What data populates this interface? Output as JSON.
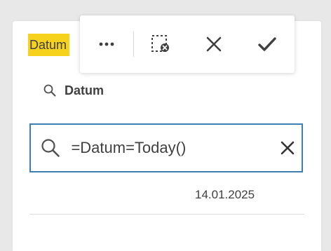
{
  "field": {
    "label": "Datum"
  },
  "toolbar": {
    "more_icon": "more-horizontal-icon",
    "clear_selection_icon": "clear-selection-icon",
    "cancel_icon": "close-icon",
    "confirm_icon": "checkmark-icon"
  },
  "search": {
    "field_label": "Datum",
    "input_value": "=Datum=Today()"
  },
  "results": [
    {
      "value": "14.01.2025"
    }
  ],
  "colors": {
    "highlight": "#f7d21d",
    "focus_border": "#3d7fb0",
    "text": "#404040"
  }
}
